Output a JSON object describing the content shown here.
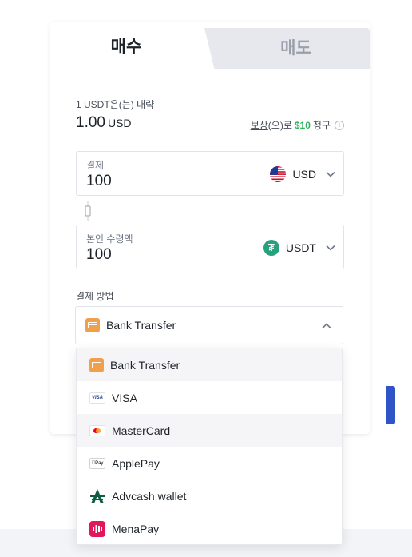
{
  "tabs": {
    "buy": "매수",
    "sell": "매도"
  },
  "rate": {
    "label": "1 USDT은(는) 대략",
    "value": "1.00",
    "unit": "USD"
  },
  "reward": {
    "link": "보상",
    "middle": "(으)로",
    "amount": "$10",
    "suffix": "청구"
  },
  "pay": {
    "label": "결제",
    "value": "100",
    "currency": "USD"
  },
  "receive": {
    "label": "본인 수령액",
    "value": "100",
    "currency": "USDT"
  },
  "payment_method": {
    "label": "결제 방법",
    "selected": "Bank Transfer"
  },
  "dropdown": {
    "items": [
      {
        "label": "Bank Transfer",
        "icon": "bank-card-icon"
      },
      {
        "label": "VISA",
        "icon": "visa-icon",
        "badge": "VISA"
      },
      {
        "label": "MasterCard",
        "icon": "mastercard-icon"
      },
      {
        "label": "ApplePay",
        "icon": "applepay-icon",
        "badge": "Pay"
      },
      {
        "label": "Advcash wallet",
        "icon": "advcash-icon"
      },
      {
        "label": "MenaPay",
        "icon": "menapay-icon"
      }
    ]
  },
  "colors": {
    "accent_green": "#2eb35a",
    "tether": "#26a17b",
    "card_orange": "#f0a04b",
    "menapay": "#e0185b",
    "button_blue": "#2e54c7"
  }
}
